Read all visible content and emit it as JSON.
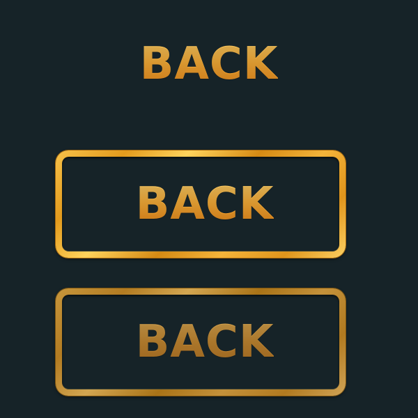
{
  "labels": {
    "plain": "BACK",
    "button_normal": "BACK",
    "button_disabled": "BACK"
  },
  "colors": {
    "background": "#162328",
    "gold_light": "#ffd16a",
    "gold_mid": "#ffb43b",
    "gold_dark": "#f08a18",
    "gold_muted": "#c98c33"
  },
  "states": {
    "button_normal": "enabled",
    "button_disabled": "disabled"
  }
}
